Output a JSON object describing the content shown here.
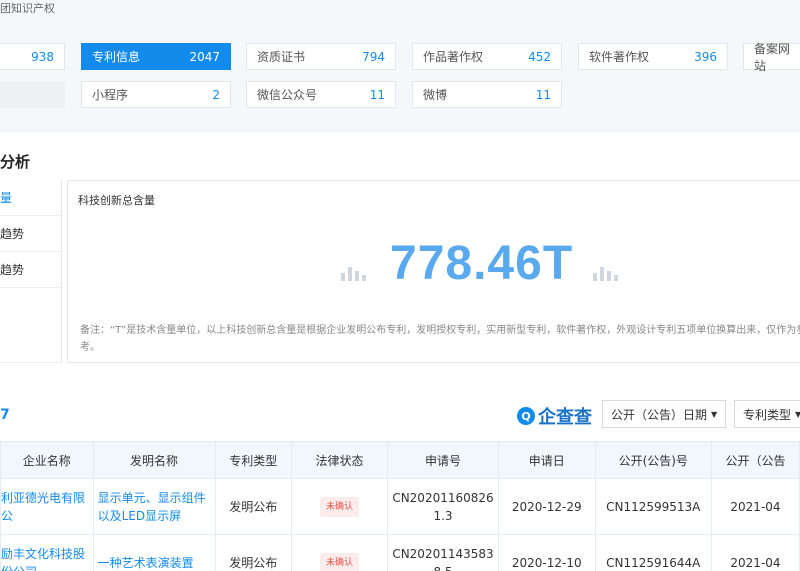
{
  "breadcrumb": "团知识产权",
  "tiles_row1": [
    {
      "label": "",
      "count": "938"
    },
    {
      "label": "专利信息",
      "count": "2047"
    },
    {
      "label": "资质证书",
      "count": "794"
    },
    {
      "label": "作品著作权",
      "count": "452"
    },
    {
      "label": "软件著作权",
      "count": "396"
    },
    {
      "label": "备案网站",
      "count": ""
    }
  ],
  "tiles_row2": [
    {
      "label": "小程序",
      "count": "2"
    },
    {
      "label": "微信公众号",
      "count": "11"
    },
    {
      "label": "微博",
      "count": "11"
    }
  ],
  "analysis": {
    "title": "分析",
    "tabs": [
      "量",
      "趋势",
      "趋势",
      ""
    ],
    "panel_title": "科技创新总含量",
    "value": "778.46T",
    "note": "备注：“T”是技术含量单位，以上科技创新总含量是根据企业发明公布专利，发明授权专利，实用新型专利，软件著作权，外观设计专利五项单位换算出来，仅作为参考。"
  },
  "patents": {
    "count": "7",
    "logo_text": "企查查",
    "filters": [
      "公开（公告）日期",
      "专利类型"
    ],
    "columns": [
      "企业名称",
      "发明名称",
      "专利类型",
      "法律状态",
      "申请号",
      "申请日",
      "公开(公告)号",
      "公开（公告"
    ],
    "rows": [
      {
        "company": "利亚德光电有限公",
        "title": "显示单元、显示组件以及LED显示屏",
        "type": "发明公布",
        "status": "未确认",
        "app_no": "CN202011608261.3",
        "app_date": "2020-12-29",
        "pub_no": "CN112599513A",
        "pub_date": "2021-04"
      },
      {
        "company": "励丰文化科技股份公司",
        "title": "一种艺术表演装置",
        "type": "发明公布",
        "status": "未确认",
        "app_no": "CN202011435838.5",
        "app_date": "2020-12-10",
        "pub_no": "CN112591644A",
        "pub_date": "2021-04"
      }
    ]
  },
  "colors": {
    "accent": "#128bed",
    "big_number": "#5aa9ee",
    "badge": "#e5534b"
  }
}
